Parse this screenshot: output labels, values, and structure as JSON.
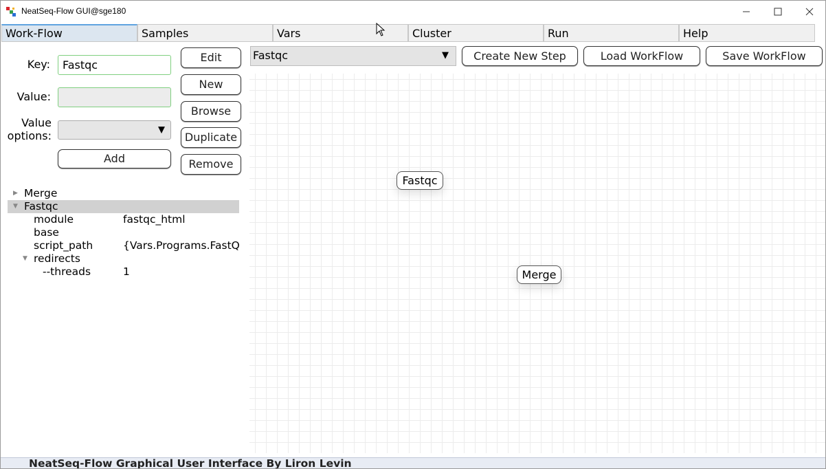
{
  "window": {
    "title": "NeatSeq-Flow GUI@sge180"
  },
  "tabs": [
    {
      "label": "Work-Flow",
      "active": true
    },
    {
      "label": "Samples"
    },
    {
      "label": "Vars"
    },
    {
      "label": "Cluster"
    },
    {
      "label": "Run"
    },
    {
      "label": "Help"
    }
  ],
  "form": {
    "key_label": "Key:",
    "key_value": "Fastqc",
    "value_label": "Value:",
    "value_value": "",
    "value_options_label_1": "Value",
    "value_options_label_2": "options:",
    "add_label": "Add"
  },
  "side_buttons": {
    "edit": "Edit",
    "new": "New",
    "browse": "Browse",
    "duplicate": "Duplicate",
    "remove": "Remove"
  },
  "tree": {
    "merge": "Merge",
    "fastqc": "Fastqc",
    "rows": [
      {
        "key": "module",
        "value": "fastqc_html"
      },
      {
        "key": "base",
        "value": ""
      },
      {
        "key": "script_path",
        "value": "{Vars.Programs.FastQC"
      }
    ],
    "redirects": "redirects",
    "threads_key": "--threads",
    "threads_value": "1"
  },
  "toolbar": {
    "step_select": "Fastqc",
    "create_new_step": "Create New Step",
    "load_workflow": "Load WorkFlow",
    "save_workflow": "Save WorkFlow"
  },
  "canvas": {
    "nodes": [
      "Fastqc",
      "Merge"
    ]
  },
  "status": {
    "text": "NeatSeq-Flow Graphical User Interface By Liron Levin"
  }
}
